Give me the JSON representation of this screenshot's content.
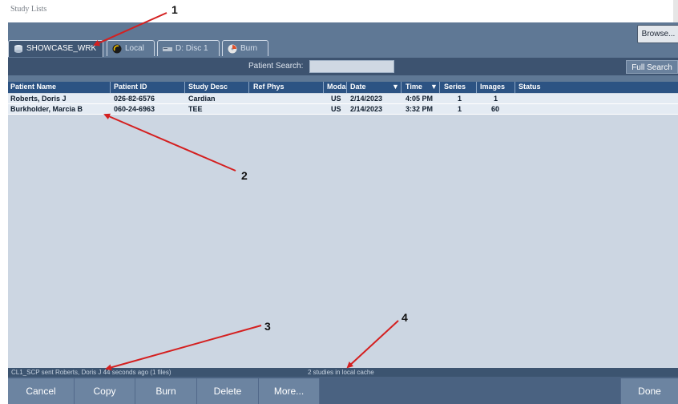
{
  "window": {
    "title": "Study Lists"
  },
  "toolbar": {
    "browse_label": "Browse..."
  },
  "tabs": [
    {
      "label": "SHOWCASE_WRK",
      "icon": "server-icon",
      "active": true
    },
    {
      "label": "Local",
      "icon": "globe-icon",
      "active": false
    },
    {
      "label": "D: Disc 1",
      "icon": "disc-drive-icon",
      "active": false
    },
    {
      "label": "Burn",
      "icon": "burn-disc-icon",
      "active": false
    }
  ],
  "search": {
    "label": "Patient Search:",
    "value": "",
    "full_search_label": "Full Search"
  },
  "table": {
    "headers": {
      "patient_name": "Patient Name",
      "patient_id": "Patient ID",
      "study_desc": "Study Desc",
      "ref_phys": "Ref Phys",
      "modality": "Moda",
      "date": "Date",
      "time": "Time",
      "series": "Series",
      "images": "Images",
      "status": "Status"
    },
    "rows": [
      {
        "patient_name": "Roberts, Doris J",
        "patient_id": "026-82-6576",
        "study_desc": "Cardian",
        "ref_phys": "",
        "modality": "US",
        "date": "2/14/2023",
        "time": "4:05 PM",
        "series": "1",
        "images": "1",
        "status": ""
      },
      {
        "patient_name": "Burkholder, Marcia B",
        "patient_id": "060-24-6963",
        "study_desc": "TEE",
        "ref_phys": "",
        "modality": "US",
        "date": "2/14/2023",
        "time": "3:32 PM",
        "series": "1",
        "images": "60",
        "status": ""
      }
    ]
  },
  "status_bar": {
    "left": "CL1_SCP sent Roberts, Doris J 44 seconds ago (1 files)",
    "center": "2 studies in local cache"
  },
  "buttons": {
    "cancel": "Cancel",
    "copy": "Copy",
    "burn": "Burn",
    "delete": "Delete",
    "more": "More...",
    "done": "Done"
  },
  "annotations": [
    "1",
    "2",
    "3",
    "4"
  ],
  "colors": {
    "arrow": "#d42020",
    "header": "#2c5383",
    "panel": "#5f7895"
  }
}
